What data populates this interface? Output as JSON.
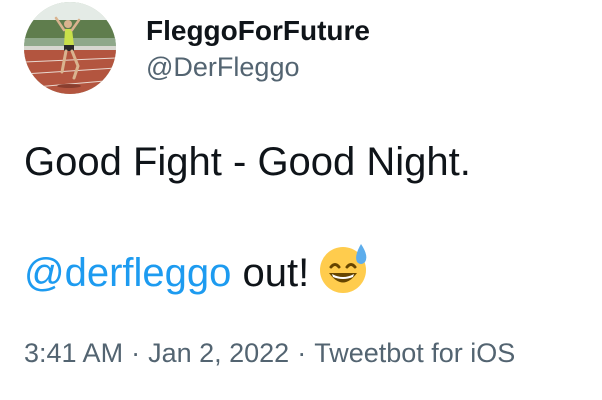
{
  "author": {
    "display_name": "FleggoForFuture",
    "handle": "@DerFleggo"
  },
  "tweet": {
    "line1": "Good Fight - Good Night.",
    "mention": "@derfleggo",
    "line2_rest": " out!",
    "emoji_icon": "grinning-face-with-sweat-icon"
  },
  "meta": {
    "time": "3:41 AM",
    "separator1": "·",
    "date": "Jan 2, 2022",
    "separator2": "·",
    "source": "Tweetbot for iOS"
  },
  "colors": {
    "link": "#1d9bf0",
    "secondary_text": "#536471",
    "primary_text": "#0f1419"
  }
}
